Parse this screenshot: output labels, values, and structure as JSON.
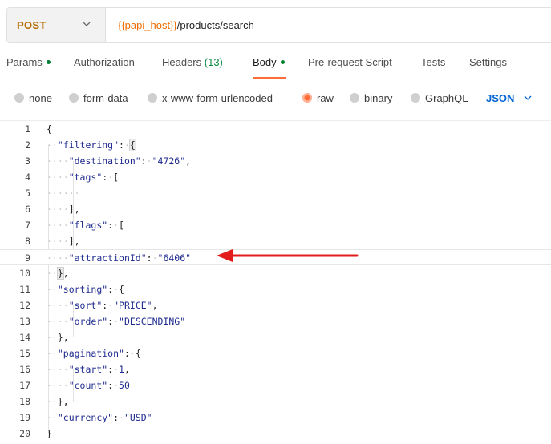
{
  "request": {
    "method": "POST",
    "url_variable": "{{papi_host}}",
    "url_path": "/products/search"
  },
  "tabs": [
    {
      "label": "Params"
    },
    {
      "label": "Authorization"
    },
    {
      "label": "Headers",
      "count": "(13)"
    },
    {
      "label": "Body"
    },
    {
      "label": "Pre-request Script"
    },
    {
      "label": "Tests"
    },
    {
      "label": "Settings"
    }
  ],
  "body_types": [
    {
      "label": "none"
    },
    {
      "label": "form-data"
    },
    {
      "label": "x-www-form-urlencoded"
    },
    {
      "label": "raw"
    },
    {
      "label": "binary"
    },
    {
      "label": "GraphQL"
    }
  ],
  "body_format": "JSON",
  "editor": {
    "line_numbers": [
      "1",
      "2",
      "3",
      "4",
      "5",
      "6",
      "7",
      "8",
      "9",
      "10",
      "11",
      "12",
      "13",
      "14",
      "15",
      "16",
      "17",
      "18",
      "19",
      "20"
    ],
    "code": {
      "l1": "{",
      "k_filtering": "\"filtering\"",
      "k_destination": "\"destination\"",
      "v_destination": "\"4726\"",
      "k_tags": "\"tags\"",
      "k_flags": "\"flags\"",
      "k_attractionId": "\"attractionId\"",
      "v_attractionId": "\"6406\"",
      "k_sorting": "\"sorting\"",
      "k_sort": "\"sort\"",
      "v_sort": "\"PRICE\"",
      "k_order": "\"order\"",
      "v_order": "\"DESCENDING\"",
      "k_pagination": "\"pagination\"",
      "k_start": "\"start\"",
      "v_start": "1",
      "k_count": "\"count\"",
      "v_count": "50",
      "k_currency": "\"currency\"",
      "v_currency": "\"USD\"",
      "l20": "}"
    }
  },
  "colors": {
    "method": "#b56a00",
    "variable": "#ef6c00",
    "accent": "#ff6c37",
    "format": "#0265d2",
    "annotation_arrow": "#e21b1b"
  }
}
